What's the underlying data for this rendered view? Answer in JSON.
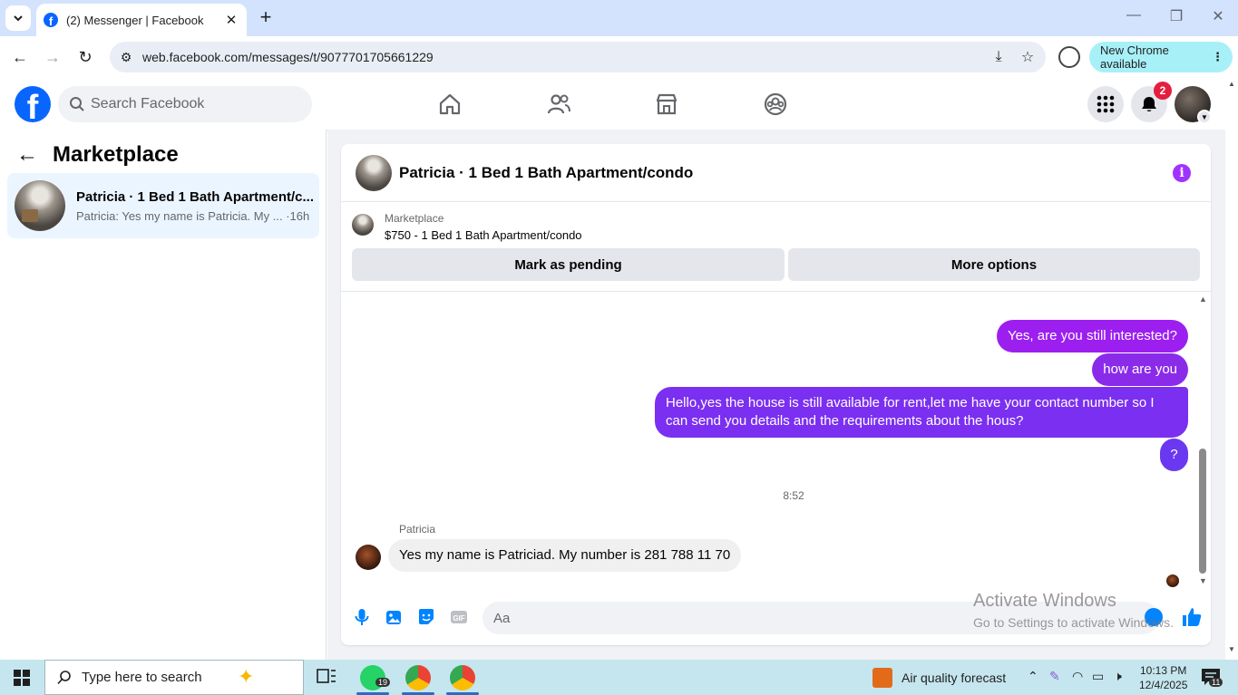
{
  "browser": {
    "tab_title": "(2) Messenger | Facebook",
    "tab_close": "✕",
    "new_tab": "+",
    "url": "web.facebook.com/messages/t/9077701705661229",
    "update_label": "New Chrome available",
    "menu_dots": "⋮"
  },
  "fb": {
    "search_placeholder": "Search Facebook",
    "notification_count": "2"
  },
  "sidebar": {
    "title": "Marketplace",
    "conversations": [
      {
        "name": "Patricia · 1 Bed 1 Bath Apartment/c...",
        "preview": "Patricia: Yes my name is Patricia. My ... ·16h"
      }
    ]
  },
  "chat": {
    "title": "Patricia · 1 Bed 1 Bath Apartment/condo",
    "listing": {
      "label": "Marketplace",
      "price_title": "$750 - 1 Bed 1 Bath Apartment/condo"
    },
    "buttons": {
      "mark_pending": "Mark as pending",
      "more_options": "More options"
    },
    "messages_out": [
      "Yes, are you still interested?",
      "how are you",
      "Hello,yes the house is still available for rent,let me have your contact number   so I can send you details and the requirements about the hous?",
      "?"
    ],
    "timestamp": "8:52",
    "incoming": {
      "sender": "Patricia",
      "text": "Yes my name is Patriciad. My number is 281 788 11 70"
    },
    "composer_placeholder": "Aa"
  },
  "watermark": {
    "title": "Activate Windows",
    "subtitle": "Go to Settings to activate Windows."
  },
  "taskbar": {
    "search_text": "Type here to search",
    "whatsapp_badge": "19",
    "weather_text": "Air quality forecast",
    "time": "10:13 PM",
    "date": "12/4/2025",
    "notif_count": "11"
  },
  "colors": {
    "fb_blue": "#0866ff",
    "messenger_purple": "#8a2be2",
    "badge_red": "#e41e3f",
    "taskbar": "#c5e6ee"
  }
}
